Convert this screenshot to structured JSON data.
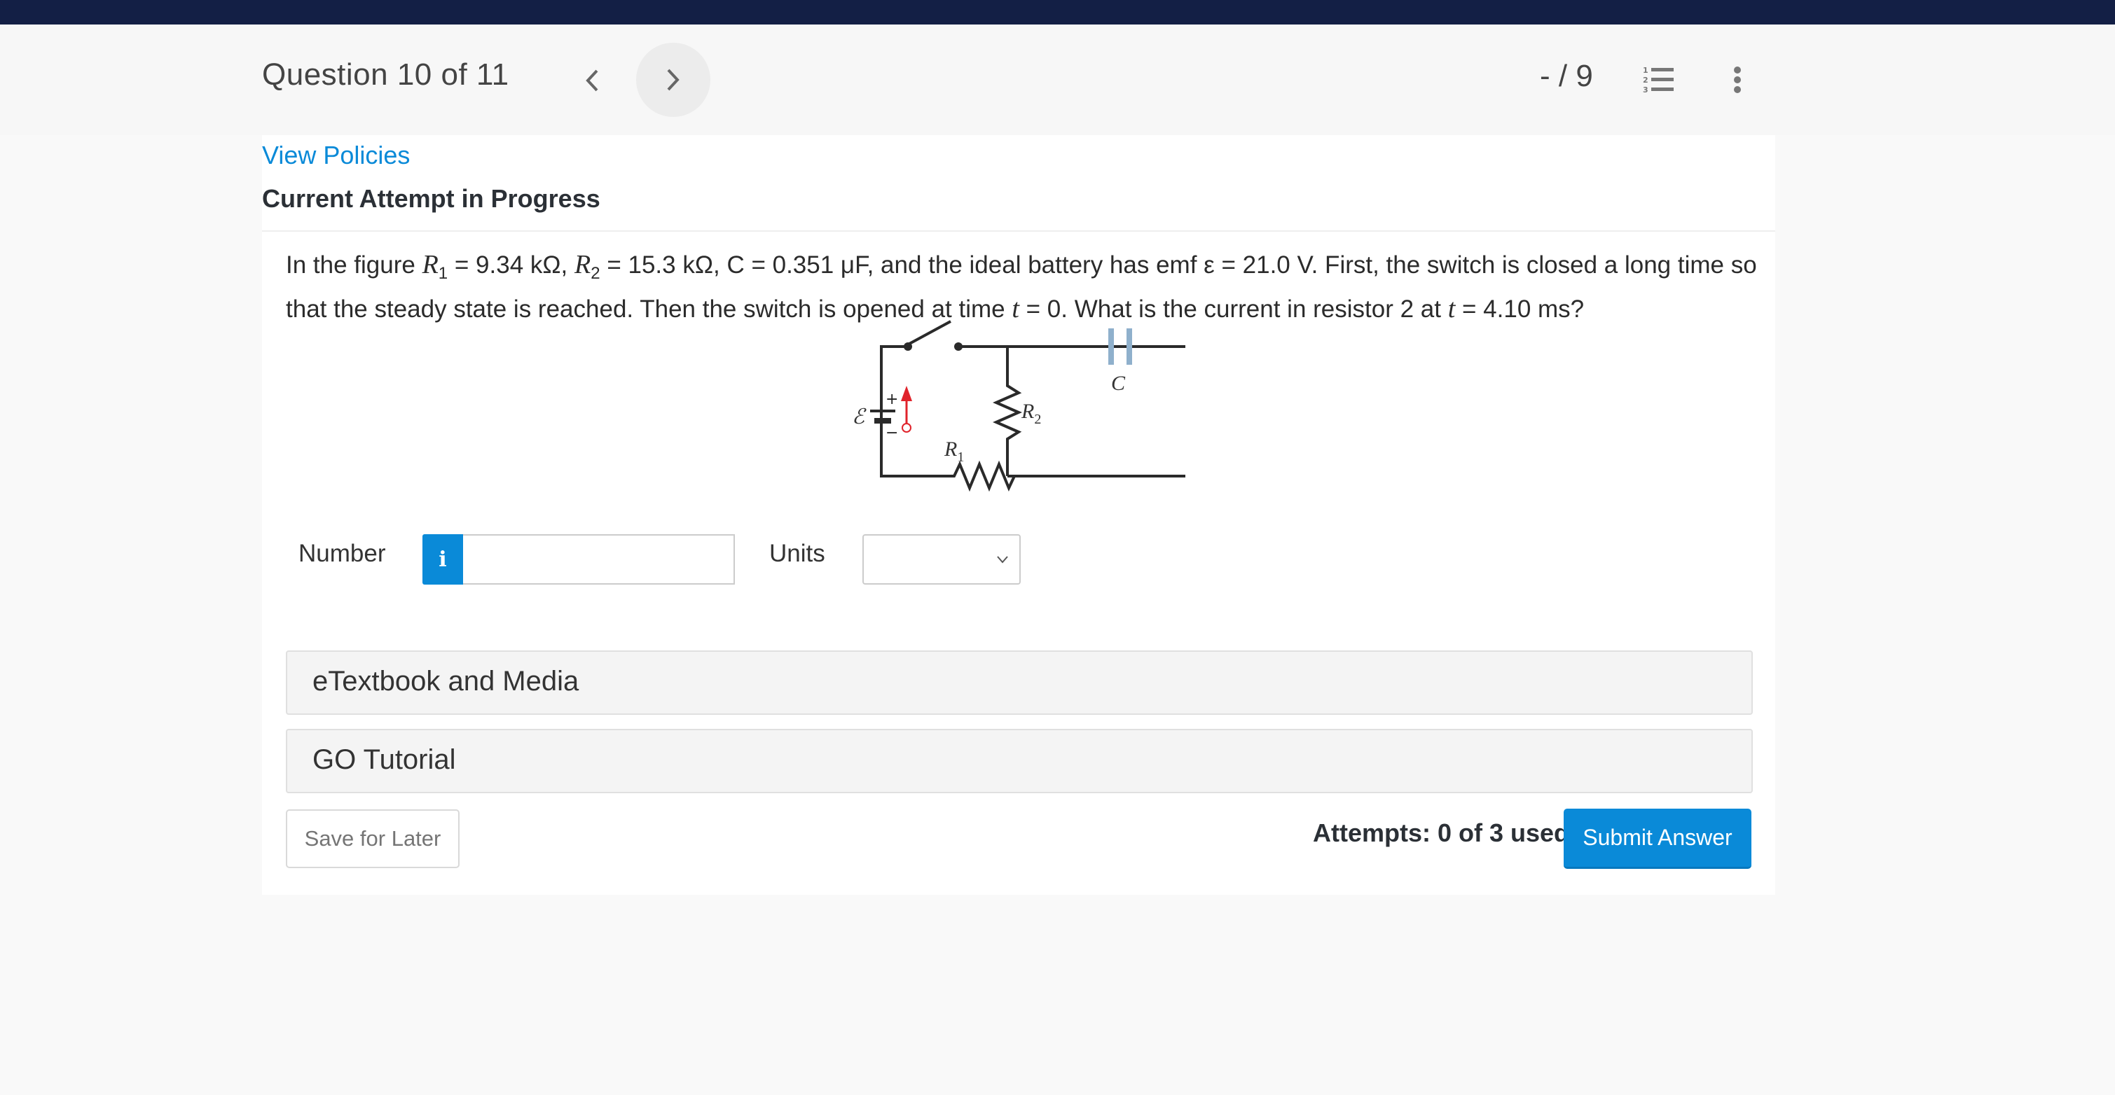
{
  "header": {
    "question_title": "Question 10 of 11",
    "score": "- / 9",
    "icons": {
      "prev": "chevron-left-icon",
      "next": "chevron-right-icon",
      "list": "numbered-list-icon",
      "more": "more-vertical-icon"
    }
  },
  "content": {
    "view_policies": "View Policies",
    "attempt_heading": "Current Attempt in Progress",
    "question": {
      "p1": "In the figure ",
      "r1_sym": "R",
      "r1_sub": "1",
      "p2": " = 9.34 kΩ, ",
      "r2_sym": "R",
      "r2_sub": "2",
      "p3": " = 15.3 kΩ, C = 0.351 μF, and the ideal battery has emf ε = 21.0 V. First, the switch is closed a long time so that the steady state is reached. Then the switch is opened at time ",
      "t1": "t",
      "p4": " = 0. What is the current in resistor 2 at ",
      "t2": "t",
      "p5": " = 4.10 ms?"
    },
    "figure": {
      "emf_label": "ℰ",
      "plus": "+",
      "minus": "−",
      "r1_label": "R",
      "r1_sub": "1",
      "r2_label": "R",
      "r2_sub": "2",
      "c_label": "C",
      "wire_color": "#2a2a2a",
      "capacitor_color": "#8fb0cc",
      "arrow_color": "#e0232b"
    }
  },
  "answer": {
    "number_label": "Number",
    "info_glyph": "i",
    "number_value": "",
    "number_placeholder": "",
    "units_label": "Units",
    "units_selected": ""
  },
  "sections": [
    {
      "label": "eTextbook and Media"
    },
    {
      "label": "GO Tutorial"
    }
  ],
  "footer": {
    "save_label": "Save for Later",
    "attempts_text": "Attempts: 0 of 3 used",
    "submit_label": "Submit Answer"
  },
  "colors": {
    "topbar": "#131f45",
    "accent": "#0a8ad8"
  }
}
